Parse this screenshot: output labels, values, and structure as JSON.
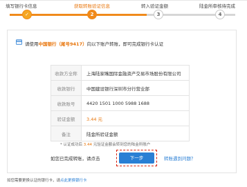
{
  "steps": [
    {
      "label": "填写银行卡信息",
      "status": "done",
      "mark": "✓"
    },
    {
      "label": "获取转账验证信息",
      "status": "active",
      "mark": "2"
    },
    {
      "label": "转入验证金额",
      "status": "todo",
      "mark": "3"
    },
    {
      "label": "陆金所审核待完成",
      "status": "todo",
      "mark": "4"
    }
  ],
  "intro": {
    "prefix": "请使用",
    "bank": "中国银行（尾号9417）",
    "suffix": "向以下账户转账，即可完成银行卡认证"
  },
  "table": [
    {
      "key": "收款方全称",
      "value": "上海陆家嘴国际金融资产交易市场股份有限公司"
    },
    {
      "key": "收款银行",
      "value": "中国建设银行深圳市分行营业部"
    },
    {
      "key": "收款账号",
      "value": "4420 1501 1000 5988 1688"
    },
    {
      "key": "验证金额",
      "value": "3.44 元"
    },
    {
      "key": "备注",
      "value": "陆金所验证金额"
    }
  ],
  "note": {
    "prefix": "* 认证成功后",
    "amount": "3.44",
    "suffix": "元验证金额会转到您的陆金所账户"
  },
  "action": {
    "prompt": "如您已完成转账，请点击",
    "next_label": "下一步",
    "problem_link": "转账遇到问题？"
  },
  "footer": {
    "prefix": "如您需要更换认证的银行卡，请",
    "change_link": "点此更换银行卡"
  },
  "colors": {
    "accent": "#f08a1b",
    "link": "#2a7fd4",
    "highlight_border": "#d81e06"
  }
}
